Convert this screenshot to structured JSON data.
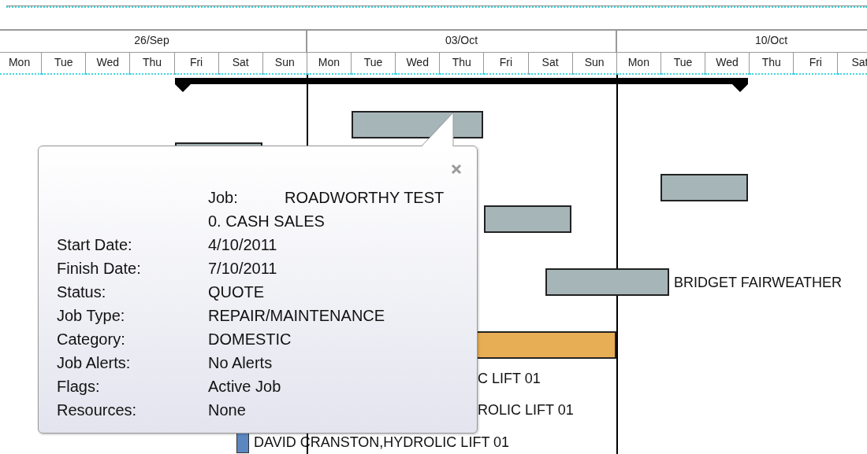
{
  "gantt": {
    "weeks": [
      "26/Sep",
      "03/Oct",
      "10/Oct"
    ],
    "days": [
      "Mon",
      "Tue",
      "Wed",
      "Thu",
      "Fri",
      "Sat",
      "Sun",
      "Mon",
      "Tue",
      "Wed",
      "Thu",
      "Fri",
      "Sat",
      "Sun",
      "Mon",
      "Tue",
      "Wed",
      "Thu",
      "Fri",
      "Sat"
    ],
    "bars": [
      {
        "kind": "summary"
      },
      {
        "kind": "task",
        "color": "#a6b5b8"
      },
      {
        "kind": "task",
        "color": "#a6b5b8"
      },
      {
        "kind": "task",
        "color": "#a6b5b8"
      },
      {
        "kind": "task",
        "color": "#a6b5b8"
      },
      {
        "kind": "task",
        "color": "#a6b5b8",
        "label": "BRIDGET FAIRWEATHER"
      },
      {
        "kind": "task",
        "color": "#e8ae56"
      },
      {
        "kind": "text",
        "label": "C LIFT 01"
      },
      {
        "kind": "text",
        "label": "ROLIC LIFT 01"
      },
      {
        "kind": "task",
        "color": "#5b86c0",
        "label": "DAVID CRANSTON,HYDROLIC LIFT 01"
      }
    ]
  },
  "tooltip": {
    "rows": [
      {
        "kind": "header",
        "label": "Job:",
        "value": "ROADWORTHY TEST"
      },
      {
        "kind": "field",
        "value": "0. CASH SALES"
      },
      {
        "kind": "field",
        "label": "Start Date:",
        "value": "4/10/2011"
      },
      {
        "kind": "field",
        "label": "Finish Date:",
        "value": "7/10/2011"
      },
      {
        "kind": "field",
        "label": "Status:",
        "value": "QUOTE"
      },
      {
        "kind": "field",
        "label": "Job Type:",
        "value": "REPAIR/MAINTENANCE"
      },
      {
        "kind": "field",
        "label": "Category:",
        "value": "DOMESTIC"
      },
      {
        "kind": "field",
        "label": "Job Alerts:",
        "value": "No Alerts"
      },
      {
        "kind": "field",
        "label": "Flags:",
        "value": "Active Job"
      },
      {
        "kind": "field",
        "label": "Resources:",
        "value": "None"
      }
    ]
  }
}
